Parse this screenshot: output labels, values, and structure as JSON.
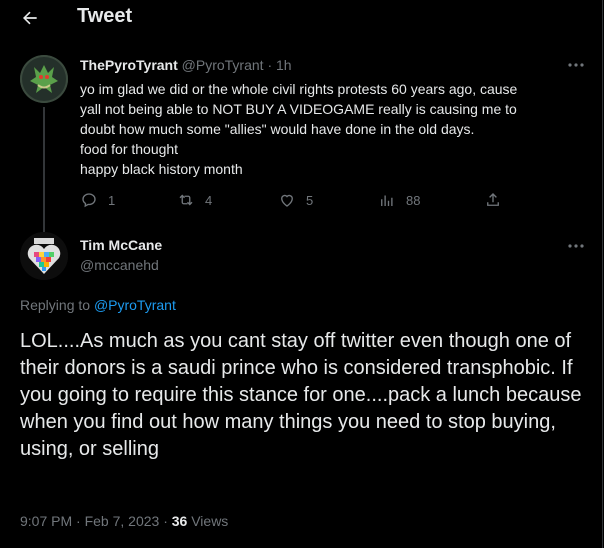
{
  "header": {
    "title": "Tweet"
  },
  "parent_tweet": {
    "display_name": "ThePyroTyrant",
    "handle": "@PyroTyrant",
    "separator": "·",
    "time": "1h",
    "text": "yo im glad we did or the whole civil rights protests 60 years ago, cause\nyall not being able to NOT BUY A VIDEOGAME really is causing me to\ndoubt how much  some  \"allies\" would have done in the old days.\nfood for thought\nhappy black history month",
    "replies": "1",
    "retweets": "4",
    "likes": "5",
    "views": "88"
  },
  "main_tweet": {
    "display_name": "Tim McCane",
    "handle": "@mccanehd",
    "replying_prefix": "Replying to",
    "replying_to": "@PyroTyrant",
    "text": "LOL....As much as you cant stay off twitter even though one of their donors is a saudi prince who is considered transphobic.  If you going to require this stance for one....pack a lunch because when you find out how many things you need to stop buying, using, or selling",
    "timestamp": "9:07 PM · Feb 7, 2023 ·",
    "views_count": "36",
    "views_label": "Views"
  },
  "colors": {
    "background": "#000000",
    "text": "#e7e9ea",
    "muted": "#71767b",
    "accent": "#1d9bf0"
  }
}
